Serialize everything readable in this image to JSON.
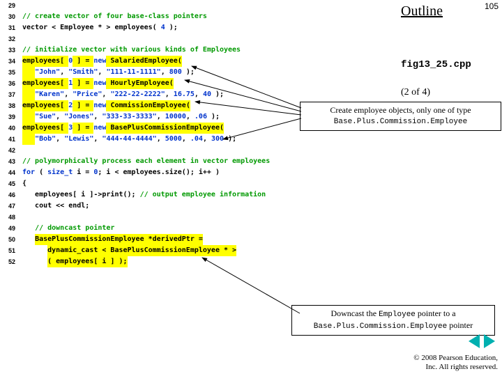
{
  "slide": {
    "outline": "Outline",
    "page_number": "105",
    "filename": "fig13_25.cpp",
    "page_of": "(2 of 4)",
    "copyright": "© 2008 Pearson Education,\nInc. All rights reserved."
  },
  "callouts": {
    "c1_a": "Create employee objects, only one of type ",
    "c1_b": "Base.Plus.Commission.Employee",
    "c2_a": "Downcast the ",
    "c2_kw1": "Employee",
    "c2_b": " pointer to a ",
    "c2_kw2": "Base.Plus.Commission.Employee",
    "c2_c": " pointer"
  },
  "lines": {
    "29": {
      "ln": "29",
      "segs": []
    },
    "30": {
      "ln": "30",
      "segs": [
        {
          "c": "cm",
          "t": "// create vector of four base-class pointers"
        }
      ]
    },
    "31": {
      "ln": "31",
      "segs": [
        {
          "c": "kw",
          "t": "vector < Employee * > employees( "
        },
        {
          "c": "bl",
          "t": "4"
        },
        {
          "c": "kw",
          "t": " );"
        }
      ]
    },
    "32": {
      "ln": "32",
      "segs": []
    },
    "33": {
      "ln": "33",
      "segs": [
        {
          "c": "cm",
          "t": "// initialize vector with various kinds of Employees"
        }
      ]
    },
    "34": {
      "ln": "34",
      "segs": [
        {
          "c": "hl",
          "t": "employees[ "
        },
        {
          "c": "bl",
          "t": "0"
        },
        {
          "c": "hl",
          "t": " ] = "
        },
        {
          "c": "bl",
          "t": "new"
        },
        {
          "c": "hl",
          "t": " SalariedEmployee("
        }
      ]
    },
    "35": {
      "ln": "35",
      "segs": [
        {
          "c": "hl",
          "t": "   "
        },
        {
          "c": "bl",
          "t": "\"John\""
        },
        {
          "c": "kw",
          "t": ", "
        },
        {
          "c": "bl",
          "t": "\"Smith\""
        },
        {
          "c": "kw",
          "t": ", "
        },
        {
          "c": "bl",
          "t": "\"111-11-1111\""
        },
        {
          "c": "kw",
          "t": ", "
        },
        {
          "c": "bl",
          "t": "800"
        },
        {
          "c": "kw",
          "t": " );"
        }
      ]
    },
    "36": {
      "ln": "36",
      "segs": [
        {
          "c": "hl",
          "t": "employees[ "
        },
        {
          "c": "bl",
          "t": "1"
        },
        {
          "c": "hl",
          "t": " ] = "
        },
        {
          "c": "bl",
          "t": "new"
        },
        {
          "c": "hl",
          "t": " HourlyEmployee("
        }
      ]
    },
    "37": {
      "ln": "37",
      "segs": [
        {
          "c": "hl",
          "t": "   "
        },
        {
          "c": "bl",
          "t": "\"Karen\""
        },
        {
          "c": "kw",
          "t": ", "
        },
        {
          "c": "bl",
          "t": "\"Price\""
        },
        {
          "c": "kw",
          "t": ", "
        },
        {
          "c": "bl",
          "t": "\"222-22-2222\""
        },
        {
          "c": "kw",
          "t": ", "
        },
        {
          "c": "bl",
          "t": "16.75"
        },
        {
          "c": "kw",
          "t": ", "
        },
        {
          "c": "bl",
          "t": "40"
        },
        {
          "c": "kw",
          "t": " );"
        }
      ]
    },
    "38": {
      "ln": "38",
      "segs": [
        {
          "c": "hl",
          "t": "employees[ "
        },
        {
          "c": "bl",
          "t": "2"
        },
        {
          "c": "hl",
          "t": " ] = "
        },
        {
          "c": "bl",
          "t": "new"
        },
        {
          "c": "hl",
          "t": " CommissionEmployee("
        }
      ]
    },
    "39": {
      "ln": "39",
      "segs": [
        {
          "c": "hl",
          "t": "   "
        },
        {
          "c": "bl",
          "t": "\"Sue\""
        },
        {
          "c": "kw",
          "t": ", "
        },
        {
          "c": "bl",
          "t": "\"Jones\""
        },
        {
          "c": "kw",
          "t": ", "
        },
        {
          "c": "bl",
          "t": "\"333-33-3333\""
        },
        {
          "c": "kw",
          "t": ", "
        },
        {
          "c": "bl",
          "t": "10000"
        },
        {
          "c": "kw",
          "t": ", "
        },
        {
          "c": "bl",
          "t": ".06"
        },
        {
          "c": "kw",
          "t": " );"
        }
      ]
    },
    "40": {
      "ln": "40",
      "segs": [
        {
          "c": "hl",
          "t": "employees[ "
        },
        {
          "c": "bl",
          "t": "3"
        },
        {
          "c": "hl",
          "t": " ] = "
        },
        {
          "c": "bl",
          "t": "new"
        },
        {
          "c": "hl",
          "t": " BasePlusCommissionEmployee("
        }
      ]
    },
    "41": {
      "ln": "41",
      "segs": [
        {
          "c": "hl",
          "t": "   "
        },
        {
          "c": "bl",
          "t": "\"Bob\""
        },
        {
          "c": "kw",
          "t": ", "
        },
        {
          "c": "bl",
          "t": "\"Lewis\""
        },
        {
          "c": "kw",
          "t": ", "
        },
        {
          "c": "bl",
          "t": "\"444-44-4444\""
        },
        {
          "c": "kw",
          "t": ", "
        },
        {
          "c": "bl",
          "t": "5000"
        },
        {
          "c": "kw",
          "t": ", "
        },
        {
          "c": "bl",
          "t": ".04"
        },
        {
          "c": "kw",
          "t": ", "
        },
        {
          "c": "bl",
          "t": "300"
        },
        {
          "c": "kw",
          "t": " );"
        }
      ]
    },
    "42": {
      "ln": "42",
      "segs": []
    },
    "43": {
      "ln": "43",
      "segs": [
        {
          "c": "cm",
          "t": "// polymorphically process each element in vector employees"
        }
      ]
    },
    "44": {
      "ln": "44",
      "segs": [
        {
          "c": "bl",
          "t": "for"
        },
        {
          "c": "kw",
          "t": " ( "
        },
        {
          "c": "bl",
          "t": "size_t"
        },
        {
          "c": "kw",
          "t": " i = "
        },
        {
          "c": "bl",
          "t": "0"
        },
        {
          "c": "kw",
          "t": "; i < employees.size(); i++ )"
        }
      ]
    },
    "45": {
      "ln": "45",
      "segs": [
        {
          "c": "kw",
          "t": "{"
        }
      ]
    },
    "46": {
      "ln": "46",
      "segs": [
        {
          "c": "kw",
          "t": "   employees[ i ]->print(); "
        },
        {
          "c": "cm",
          "t": "// output employee information"
        }
      ]
    },
    "47": {
      "ln": "47",
      "segs": [
        {
          "c": "kw",
          "t": "   cout << endl;"
        }
      ]
    },
    "48": {
      "ln": "48",
      "segs": []
    },
    "49": {
      "ln": "49",
      "segs": [
        {
          "c": "nm",
          "t": "   "
        },
        {
          "c": "cm",
          "t": "// downcast pointer"
        }
      ]
    },
    "50": {
      "ln": "50",
      "segs": [
        {
          "c": "kw",
          "t": "   "
        },
        {
          "c": "hl",
          "t": "BasePlusCommissionEmployee *derivedPtr ="
        }
      ]
    },
    "51": {
      "ln": "51",
      "segs": [
        {
          "c": "kw",
          "t": "      "
        },
        {
          "c": "hl",
          "t": "dynamic_cast < BasePlusCommissionEmployee * >"
        }
      ]
    },
    "52": {
      "ln": "52",
      "segs": [
        {
          "c": "kw",
          "t": "      "
        },
        {
          "c": "hl",
          "t": "( employees[ i ] );"
        }
      ]
    }
  },
  "line_order": [
    "29",
    "30",
    "31",
    "32",
    "33",
    "34",
    "35",
    "36",
    "37",
    "38",
    "39",
    "40",
    "41",
    "42",
    "43",
    "44",
    "45",
    "46",
    "47",
    "48",
    "49",
    "50",
    "51",
    "52"
  ]
}
